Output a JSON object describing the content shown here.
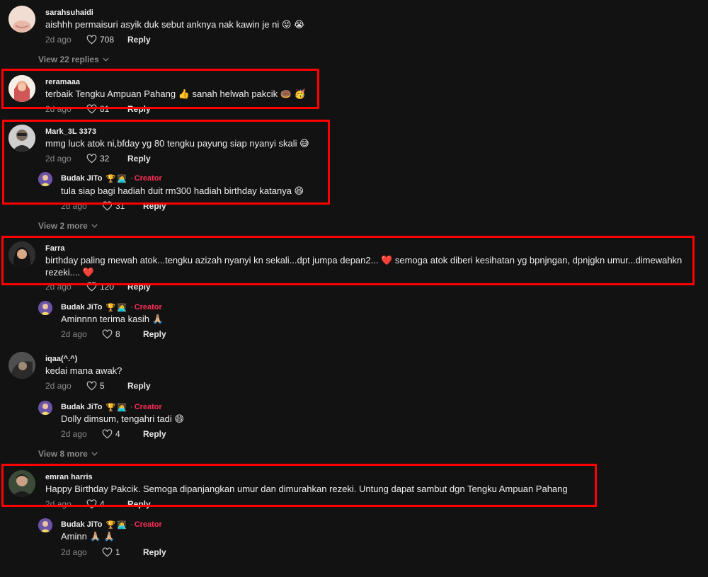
{
  "comments": [
    {
      "username": "sarahsuhaidi",
      "text": "aishhh permaisuri asyik duk sebut anknya nak kawin je ni 😝 😭",
      "date": "2d ago",
      "likes": "708",
      "reply": "Reply",
      "view_more": "View 22 replies"
    },
    {
      "username": "reramaaa",
      "text": "terbaik Tengku Ampuan Pahang 👍 sanah helwah pakcik 🍩 🥳",
      "date": "2d ago",
      "likes": "81",
      "reply": "Reply"
    },
    {
      "username": "Mark_3L 3373",
      "text": "mmg luck atok ni,bfday yg 80 tengku payung siap nyanyi skali 😅",
      "date": "2d ago",
      "likes": "32",
      "reply": "Reply",
      "creator_reply": {
        "username": "Budak JiTo",
        "creator_label": "Creator",
        "text": "tula siap bagi hadiah duit rm300 hadiah birthday katanya 😆",
        "date": "2d ago",
        "likes": "31",
        "reply": "Reply"
      },
      "view_more": "View 2 more"
    },
    {
      "username": "Farra",
      "text": "birthday paling mewah atok...tengku azizah nyanyi kn sekali...dpt jumpa depan2... ❤️ semoga atok diberi kesihatan yg bpnjngan, dpnjgkn umur...dimewahkn rezeki.... ❤️",
      "date": "2d ago",
      "likes": "120",
      "reply": "Reply",
      "creator_reply": {
        "username": "Budak JiTo",
        "creator_label": "Creator",
        "text": "Aminnnn terima kasih 🙏🏼",
        "date": "2d ago",
        "likes": "8",
        "reply": "Reply"
      }
    },
    {
      "username": "iqaa(^.^)",
      "text": "kedai mana awak?",
      "date": "2d ago",
      "likes": "5",
      "reply": "Reply",
      "creator_reply": {
        "username": "Budak JiTo",
        "creator_label": "Creator",
        "text": "Dolly dimsum, tengahri tadi 😄",
        "date": "2d ago",
        "likes": "4",
        "reply": "Reply"
      },
      "view_more": "View 8 more"
    },
    {
      "username": "emran harris",
      "text": "Happy Birthday Pakcik. Semoga dipanjangkan umur dan dimurahkan rezeki. Untung dapat sambut dgn Tengku Ampuan Pahang",
      "date": "2d ago",
      "likes": "4",
      "reply": "Reply",
      "creator_reply": {
        "username": "Budak JiTo",
        "creator_label": "Creator",
        "text": "Aminn 🙏🏼 🙏🏼",
        "date": "2d ago",
        "likes": "1",
        "reply": "Reply"
      }
    }
  ],
  "colors": {
    "background": "#121212",
    "highlight_box": "#ff0000",
    "creator_label": "#fe2c55"
  },
  "icons": {
    "like": "heart-outline-icon",
    "expand": "chevron-down-icon"
  }
}
